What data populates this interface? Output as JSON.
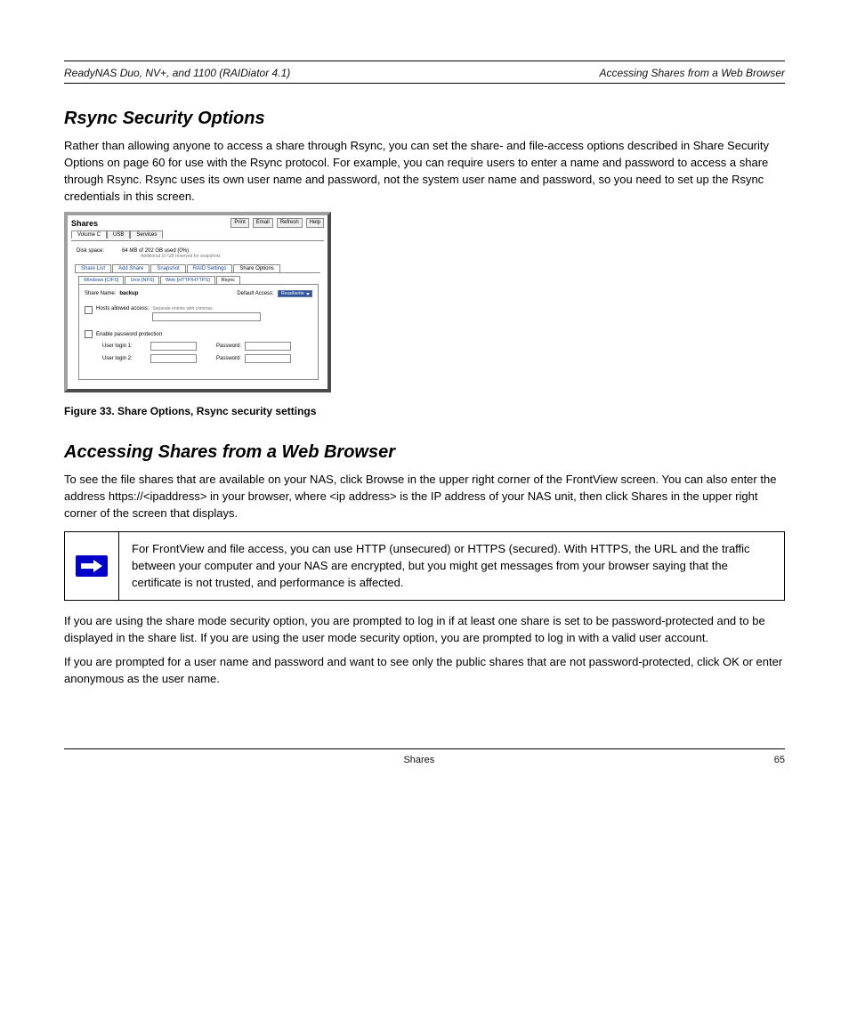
{
  "header": {
    "left": "ReadyNAS Duo, NV+, and 1100 (RAIDiator 4.1)",
    "right": "Accessing Shares from a Web Browser"
  },
  "title": "Rsync Security Options",
  "intro": "Rather than allowing anyone to access a share through Rsync, you can set the share- and file-access options described in Share Security Options on page 60 for use with the Rsync protocol. For example, you can require users to enter a name and password to access a share through Rsync. Rsync uses its own user name and password, not the system user name and password, so you need to set up the Rsync credentials in this screen.",
  "fig_caption": "Figure 33. Share Options, Rsync security settings",
  "sec2_title": "Accessing Shares from a Web Browser",
  "sec2_p1": "To see the file shares that are available on your NAS, click Browse in the upper right corner of the FrontView screen. You can also enter the address https://<ipaddress> in your browser, where <ip address> is the IP address of your NAS unit, then click Shares in the upper right corner of the screen that displays.",
  "note_text": "For FrontView and file access, you can use HTTP (unsecured) or HTTPS (secured). With HTTPS, the URL and the traffic between your computer and your NAS are encrypted, but you might get messages from your browser saying that the certificate is not trusted, and performance is affected.",
  "sec2_p2": "If you are using the share mode security option, you are prompted to log in if at least one share is set to be password-protected and to be displayed in the share list. If you are using the user mode security option, you are prompted to log in with a valid user account.",
  "sec2_p3": "If you are prompted for a user name and password and want to see only the public shares that are not password-protected, click OK or enter anonymous as the user name.",
  "footer": {
    "center": "Shares",
    "right": "65"
  },
  "shot": {
    "window_title": "Shares",
    "top_buttons": [
      "Print",
      "Email",
      "Refresh",
      "Help"
    ],
    "top_tabs": [
      "Volume C",
      "USB",
      "Services"
    ],
    "disk_label": "Disk space:",
    "disk_value": "64 MB of 202 GB used (0%)",
    "disk_sub": "Additional 10 GB reserved for snapshots",
    "inner_tabs": [
      "Share List",
      "Add Share",
      "Snapshot",
      "RAID Settings",
      "Share Options"
    ],
    "active_inner_tab": "Share Options",
    "proto_tabs": [
      "Windows [CIFS]",
      "Unix [NFS]",
      "Web [HTTP/HTTPS]",
      "Rsync"
    ],
    "active_proto_tab": "Rsync",
    "share_name_label": "Share Name:",
    "share_name_value": "backup",
    "default_access_label": "Default Access:",
    "default_access_value": "Read/write",
    "hosts_checkbox_label": "Hosts allowed access:",
    "hosts_hint": "Separate entries with commas",
    "enable_pw_label": "Enable password protection",
    "user_login1_label": "User login 1:",
    "user_login2_label": "User login 2:",
    "password_label": "Password:"
  }
}
